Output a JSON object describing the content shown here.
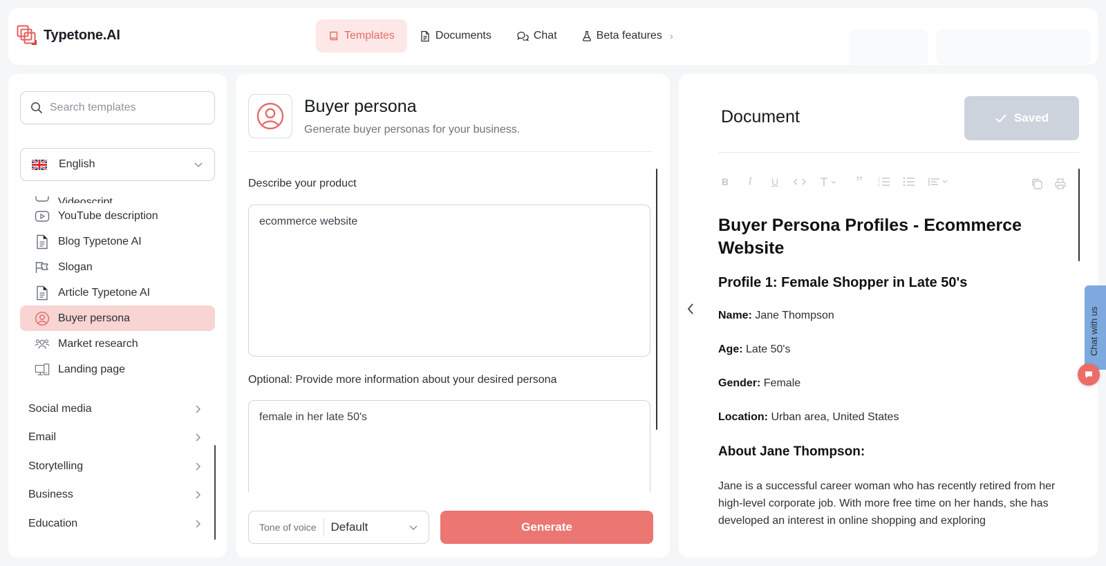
{
  "brand": {
    "name": "Typetone.AI"
  },
  "nav": {
    "items": [
      {
        "label": "Templates",
        "icon": "book-icon",
        "active": true
      },
      {
        "label": "Documents",
        "icon": "document-icon",
        "active": false
      },
      {
        "label": "Chat",
        "icon": "chat-bubbles-icon",
        "active": false
      },
      {
        "label": "Beta features",
        "icon": "flask-icon",
        "active": false
      }
    ]
  },
  "sidebar": {
    "search_placeholder": "Search templates",
    "language": "English",
    "templates": [
      {
        "label": "Videoscript",
        "icon": "video-icon",
        "active": false
      },
      {
        "label": "YouTube description",
        "icon": "youtube-icon",
        "active": false
      },
      {
        "label": "Blog Typetone AI",
        "icon": "document-icon",
        "active": false
      },
      {
        "label": "Slogan",
        "icon": "megaphone-icon",
        "active": false
      },
      {
        "label": "Article Typetone AI",
        "icon": "document-icon",
        "active": false
      },
      {
        "label": "Buyer persona",
        "icon": "user-circle-icon",
        "active": true
      },
      {
        "label": "Market research",
        "icon": "users-icon",
        "active": false
      },
      {
        "label": "Landing page",
        "icon": "devices-icon",
        "active": false
      }
    ],
    "categories": [
      {
        "label": "Social media"
      },
      {
        "label": "Email"
      },
      {
        "label": "Storytelling"
      },
      {
        "label": "Business"
      },
      {
        "label": "Education"
      }
    ]
  },
  "template": {
    "title": "Buyer persona",
    "subtitle": "Generate buyer personas for your business.",
    "field1_label": "Describe your product",
    "field1_value": "ecommerce website",
    "field2_label": "Optional: Provide more information about your desired persona",
    "field2_value": "female in her late 50's",
    "tone_label": "Tone of voice",
    "tone_value": "Default",
    "generate_label": "Generate"
  },
  "document": {
    "title": "Document",
    "saved_label": "Saved",
    "heading": "Buyer Persona Profiles - Ecommerce Website",
    "profile_heading": "Profile 1: Female Shopper in Late 50's",
    "fields": [
      {
        "key": "Name:",
        "value": "Jane Thompson"
      },
      {
        "key": "Age:",
        "value": "Late 50's"
      },
      {
        "key": "Gender:",
        "value": "Female"
      },
      {
        "key": "Location:",
        "value": "Urban area, United States"
      }
    ],
    "about_heading": "About Jane Thompson:",
    "about_text": "Jane is a successful career woman who has recently retired from her high-level corporate job. With more free time on her hands, she has developed an interest in online shopping and exploring"
  },
  "chat_widget": {
    "label": "Chat with us"
  },
  "colors": {
    "accent": "#eb7672",
    "accent_light": "#fde8e7",
    "saved_button": "#cdd3dc"
  }
}
